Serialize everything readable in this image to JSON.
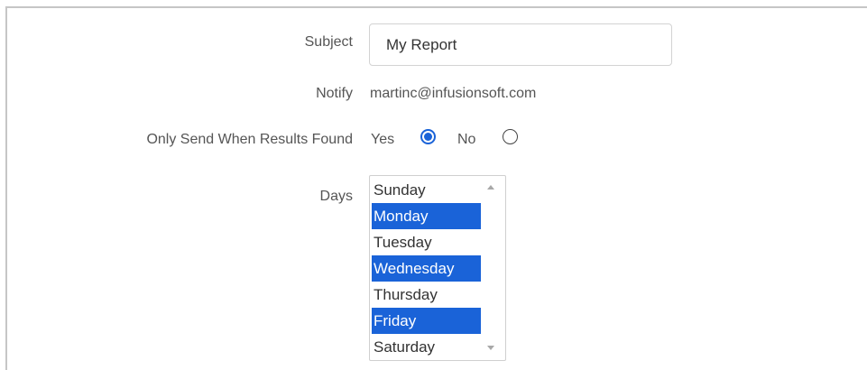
{
  "form": {
    "subject": {
      "label": "Subject",
      "value": "My Report"
    },
    "notify": {
      "label": "Notify",
      "value": "martinc@infusionsoft.com"
    },
    "only_send": {
      "label": "Only Send When Results Found",
      "options": [
        {
          "label": "Yes",
          "checked": true
        },
        {
          "label": "No",
          "checked": false
        }
      ]
    },
    "days": {
      "label": "Days",
      "options": [
        {
          "label": "Sunday",
          "selected": false
        },
        {
          "label": "Monday",
          "selected": true
        },
        {
          "label": "Tuesday",
          "selected": false
        },
        {
          "label": "Wednesday",
          "selected": true
        },
        {
          "label": "Thursday",
          "selected": false
        },
        {
          "label": "Friday",
          "selected": true
        },
        {
          "label": "Saturday",
          "selected": false
        }
      ]
    }
  },
  "colors": {
    "accent": "#1a63d8",
    "label": "#555555",
    "border": "#d3d3d3"
  },
  "icons": {
    "scroll_up": "scroll-up-arrow-icon",
    "scroll_down": "scroll-down-arrow-icon"
  }
}
